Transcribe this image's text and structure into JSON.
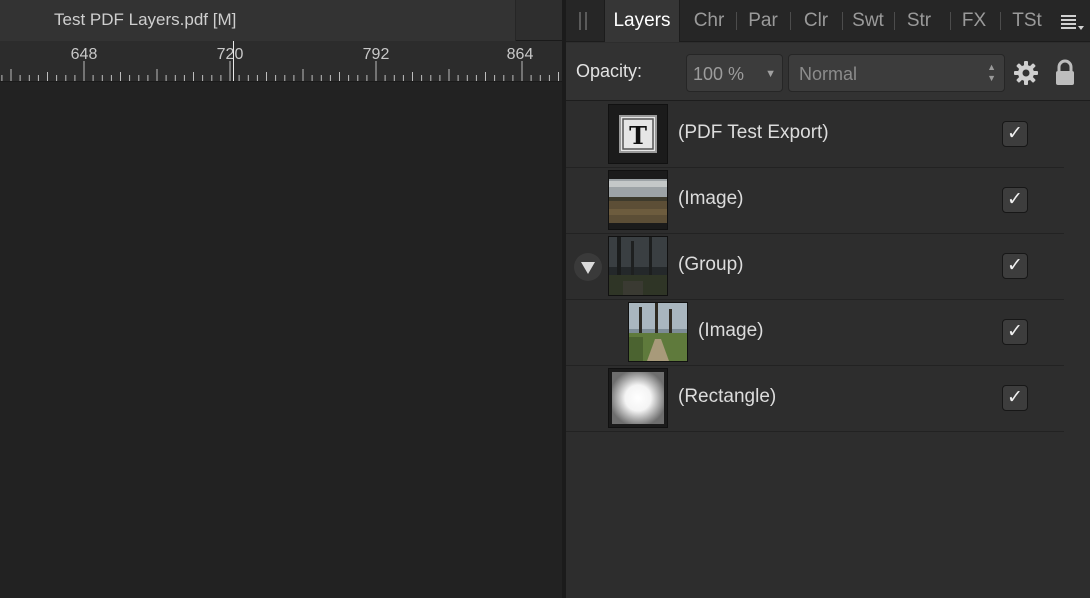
{
  "document": {
    "tab_title": "Test PDF Layers.pdf [M]",
    "ruler_labels": [
      "648",
      "720",
      "792",
      "864"
    ]
  },
  "panel": {
    "tabs": [
      {
        "label": "Layers",
        "active": true
      },
      {
        "label": "Chr",
        "active": false
      },
      {
        "label": "Par",
        "active": false
      },
      {
        "label": "Clr",
        "active": false
      },
      {
        "label": "Swt",
        "active": false
      },
      {
        "label": "Str",
        "active": false
      },
      {
        "label": "FX",
        "active": false
      },
      {
        "label": "TSt",
        "active": false
      }
    ],
    "menu_icon": "panel-menu-icon"
  },
  "controls": {
    "opacity_label": "Opacity:",
    "opacity_value": "100 %",
    "blend_mode": "Normal",
    "settings_icon": "gear-icon",
    "lock_icon": "lock-icon"
  },
  "layers": [
    {
      "name": "(PDF Test Export)",
      "thumbnail": "text-frame",
      "visible": true,
      "level": 0,
      "expander": false
    },
    {
      "name": "(Image)",
      "thumbnail": "landscape-photo",
      "visible": true,
      "level": 0,
      "expander": false
    },
    {
      "name": "(Group)",
      "thumbnail": "dark-trees-photo",
      "visible": true,
      "level": 0,
      "expander": true
    },
    {
      "name": "(Image)",
      "thumbnail": "trees-path-photo",
      "visible": true,
      "level": 1,
      "expander": false
    },
    {
      "name": "(Rectangle)",
      "thumbnail": "white-vignette",
      "visible": true,
      "level": 0,
      "expander": false
    }
  ],
  "colors": {
    "panel_bg": "#2d2d2d",
    "canvas_bg": "#222222",
    "tab_active_bg": "#363636",
    "checkbox_bg": "#3d3d3d"
  }
}
